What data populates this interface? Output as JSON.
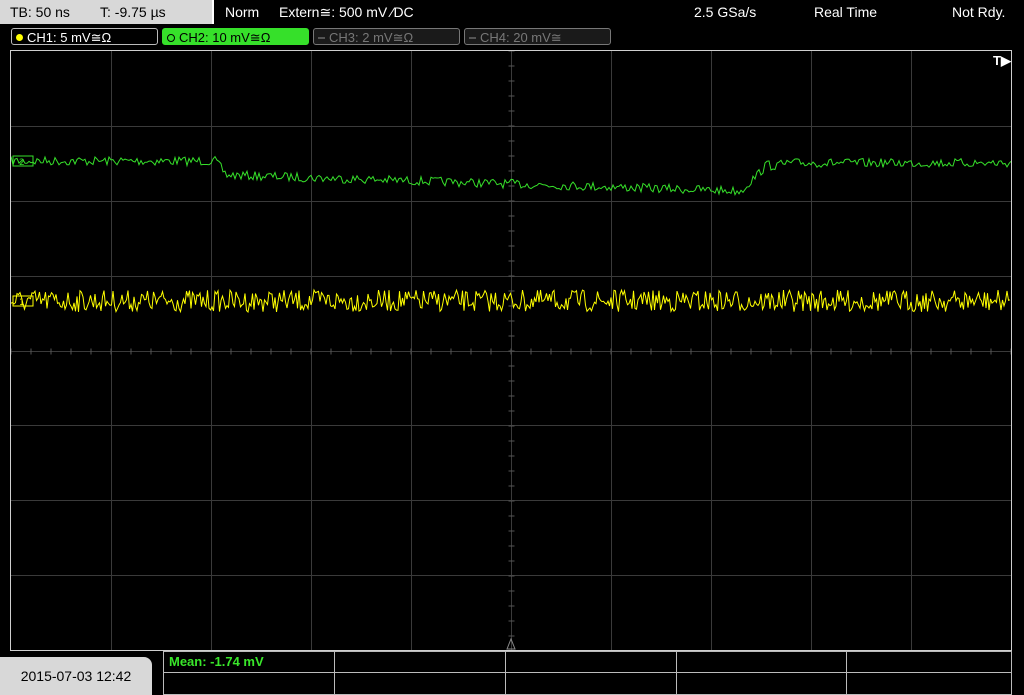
{
  "topbar": {
    "timebase": "TB: 50 ns",
    "trigger_time": "T: -9.75 µs",
    "mode": "Norm",
    "trigger_source": "Extern≅: 500 mV ⁄DC",
    "sample_rate": "2.5 GSa/s",
    "acq_mode": "Real Time",
    "status": "Not Rdy."
  },
  "channels": [
    {
      "label": "CH1: 5 mV≅Ω",
      "color": "#ffff00",
      "active": true
    },
    {
      "label": "CH2: 10 mV≅Ω",
      "color": "#36e02a",
      "active": true
    },
    {
      "label": "CH3: 2 mV≅Ω",
      "color": "#888888",
      "active": false
    },
    {
      "label": "CH4: 20 mV≅",
      "color": "#888888",
      "active": false
    }
  ],
  "screen": {
    "trigger_marker": "T▶",
    "ch1_marker": "1",
    "ch2_marker": "2"
  },
  "bottom": {
    "datetime": "2015-07-03 12:42",
    "mean": "Mean: -1.74 mV"
  }
}
